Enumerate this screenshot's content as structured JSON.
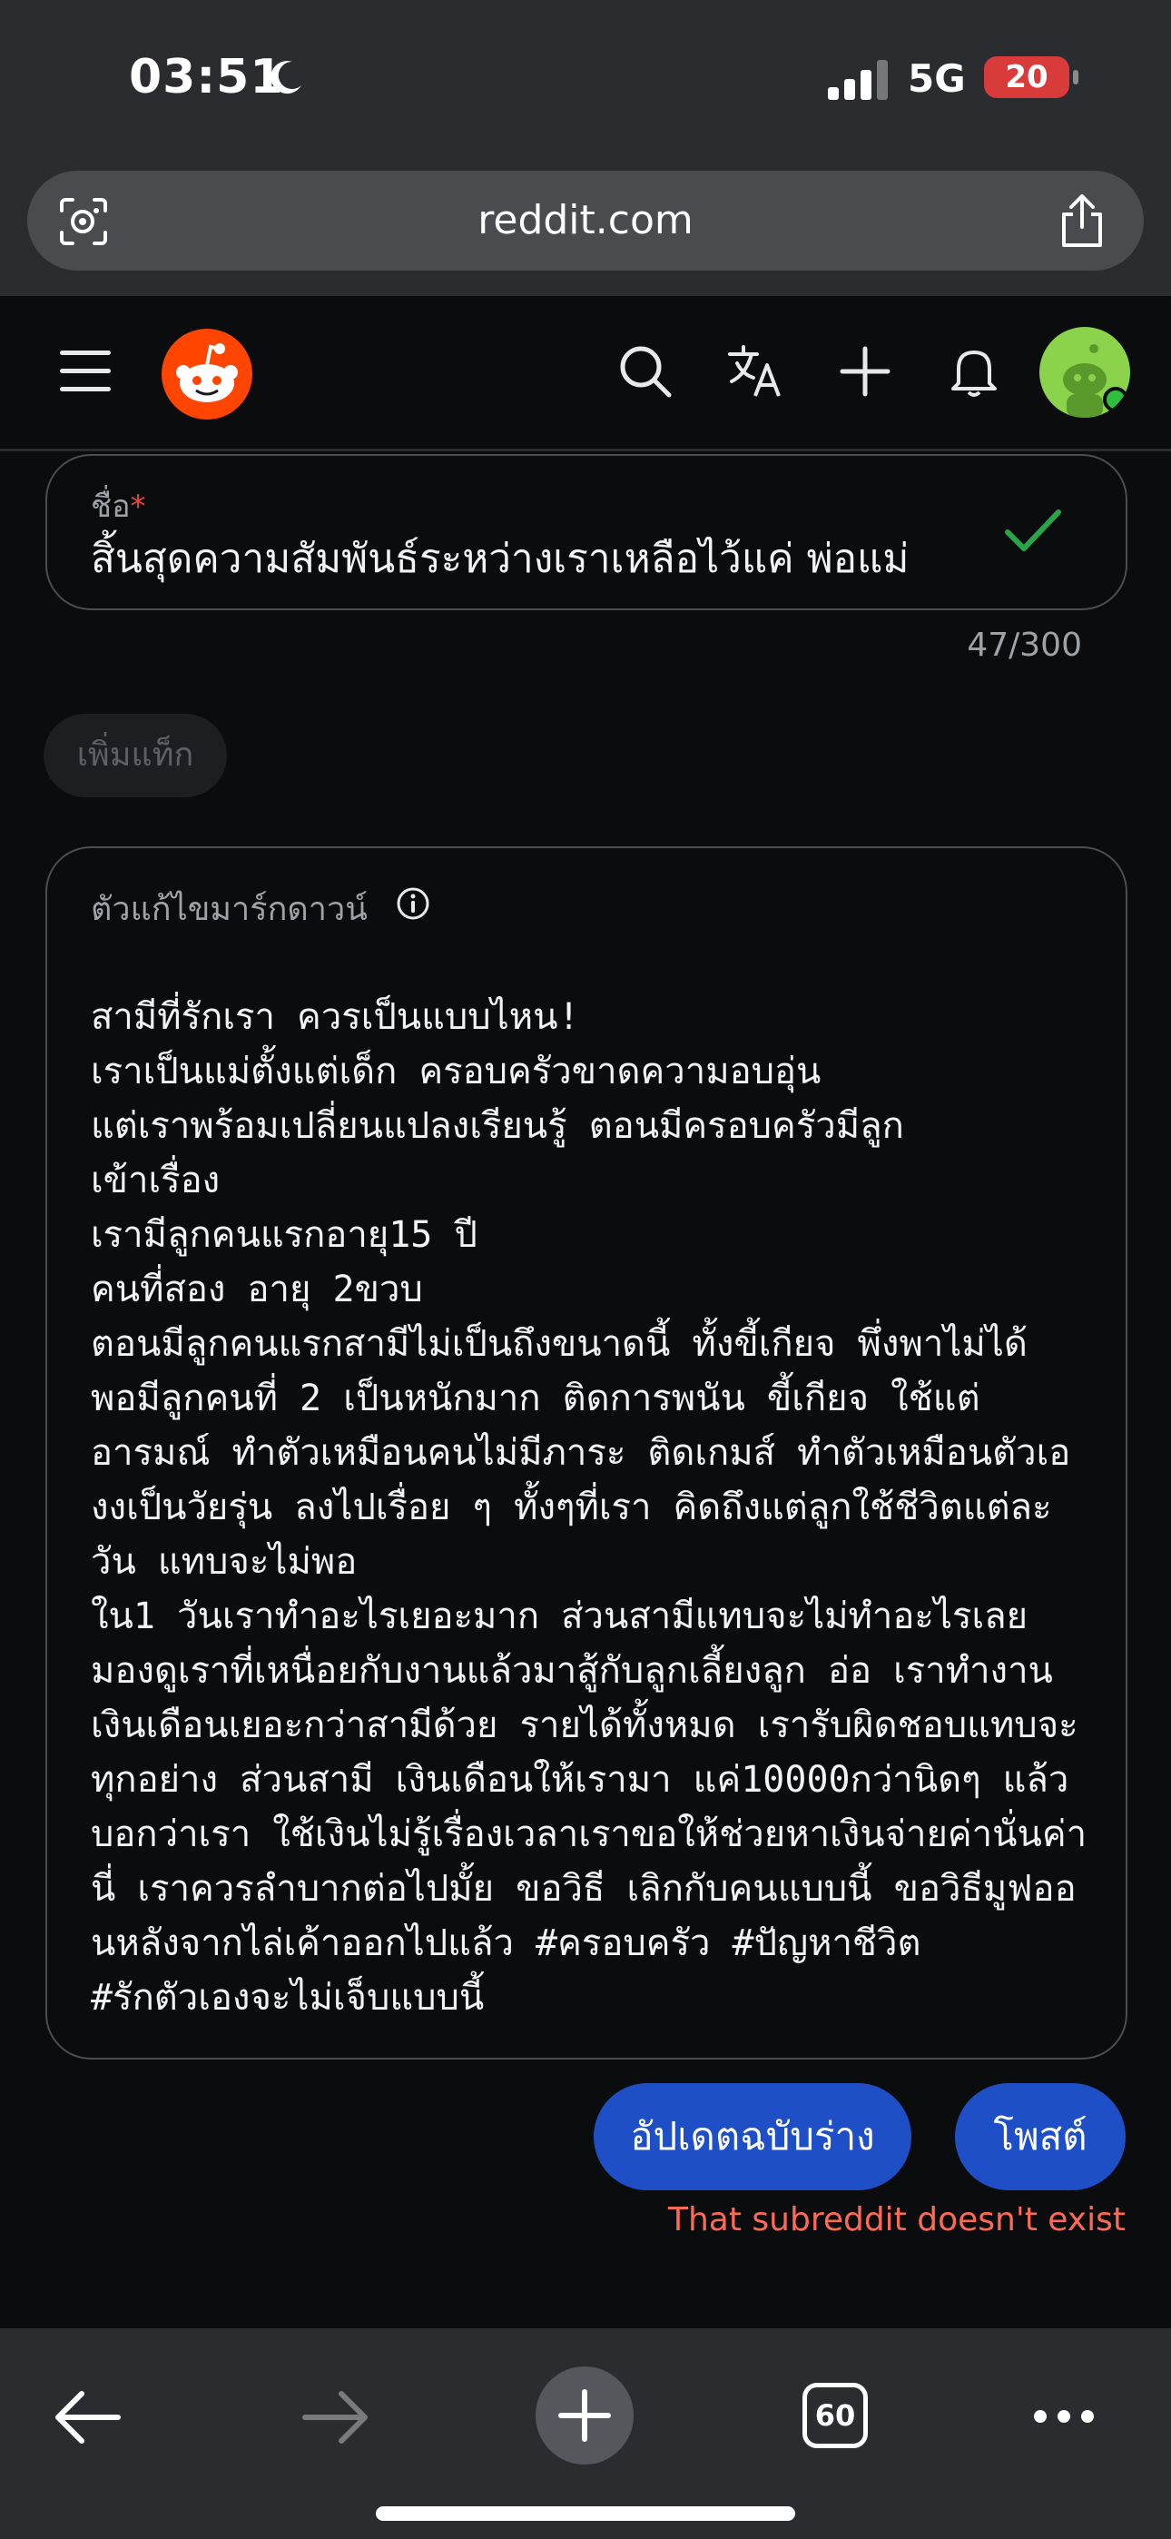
{
  "status_bar": {
    "time": "03:51",
    "network": "5G",
    "battery": "20"
  },
  "browser": {
    "url": "reddit.com"
  },
  "form": {
    "title_label": "ชื่อ",
    "title_required": "*",
    "title_value": "สิ้นสุดความสัมพันธ์ระหว่างเราเหลือไว้แค่ พ่อแม่",
    "title_counter": "47/300",
    "add_tag_label": "เพิ่มแท็ก",
    "editor_label": "ตัวแก้ไขมาร์กดาวน์",
    "body_lines": [
      "สามีที่รักเรา ควรเป็นแบบไหน!",
      "เราเป็นแม่ตั้งแต่เด็ก ครอบครัวขาดความอบอุ่น",
      "แต่เราพร้อมเปลี่ยนแปลงเรียนรู้ ตอนมีครอบครัวมีลูก",
      "เข้าเรื่อง",
      "เรามีลูกคนแรกอายุ15 ปี",
      "คนที่สอง อายุ 2ขวบ",
      "ตอนมีลูกคนแรกสามีไม่เป็นถึงขนาดนี้ ทั้งขี้เกียจ พึ่งพาไม่ได้",
      "พอมีลูกคนที่ 2 เป็นหนักมาก ติดการพนัน ขี้เกียจ ใช้แต่",
      "อารมณ์ ทำตัวเหมือนคนไม่มีภาระ ติดเกมส์ ทำตัวเหมือนตัวเอ",
      "งงเป็นวัยรุ่น ลงไปเรื่อย ๆ ทั้งๆที่เรา คิดถึงแต่ลูกใช้ชีวิตแต่ละ",
      "วัน แทบจะไม่พอ",
      "ใน1 วันเราทำอะไรเยอะมาก ส่วนสามีแทบจะไม่ทำอะไรเลย",
      "มองดูเราที่เหนื่อยกับงานแล้วมาสู้กับลูกเลี้ยงลูก อ่อ เราทำงาน",
      "เงินเดือนเยอะกว่าสามีด้วย รายได้ทั้งหมด เรารับผิดชอบแทบจะ",
      "ทุกอย่าง ส่วนสามี เงินเดือนให้เรามา แค่10000กว่านิดๆ แล้ว",
      "บอกว่าเรา ใช้เงินไม่รู้เรื่องเวลาเราขอให้ช่วยหาเงินจ่ายค่านั่นค่า",
      "นี่ เราควรลำบากต่อไปมั้ย ขอวิธี เลิกกับคนแบบนี้ ขอวิธีมูฟออ",
      "นหลังจากไล่เค้าออกไปแล้ว #ครอบครัว #ปัญหาชีวิต",
      "#รักตัวเองจะไม่เจ็บแบบนี้"
    ],
    "update_draft_label": "อัปเดตฉบับร่าง",
    "post_label": "โพสต์",
    "error_message": "That subreddit doesn't exist"
  },
  "toolbar": {
    "tab_count": "60"
  },
  "colors": {
    "accent": "#1f4fc7",
    "error": "#ff6a55",
    "success": "#2aa44a",
    "brand": "#ff4500"
  },
  "icons": [
    "moon-icon",
    "signal-icon",
    "lens-icon",
    "share-icon",
    "menu-icon",
    "reddit-logo",
    "search-icon",
    "translate-icon",
    "plus-icon",
    "bell-icon",
    "avatar",
    "check-icon",
    "info-icon",
    "back-icon",
    "forward-icon",
    "new-tab-icon",
    "tabs-icon",
    "more-icon"
  ]
}
